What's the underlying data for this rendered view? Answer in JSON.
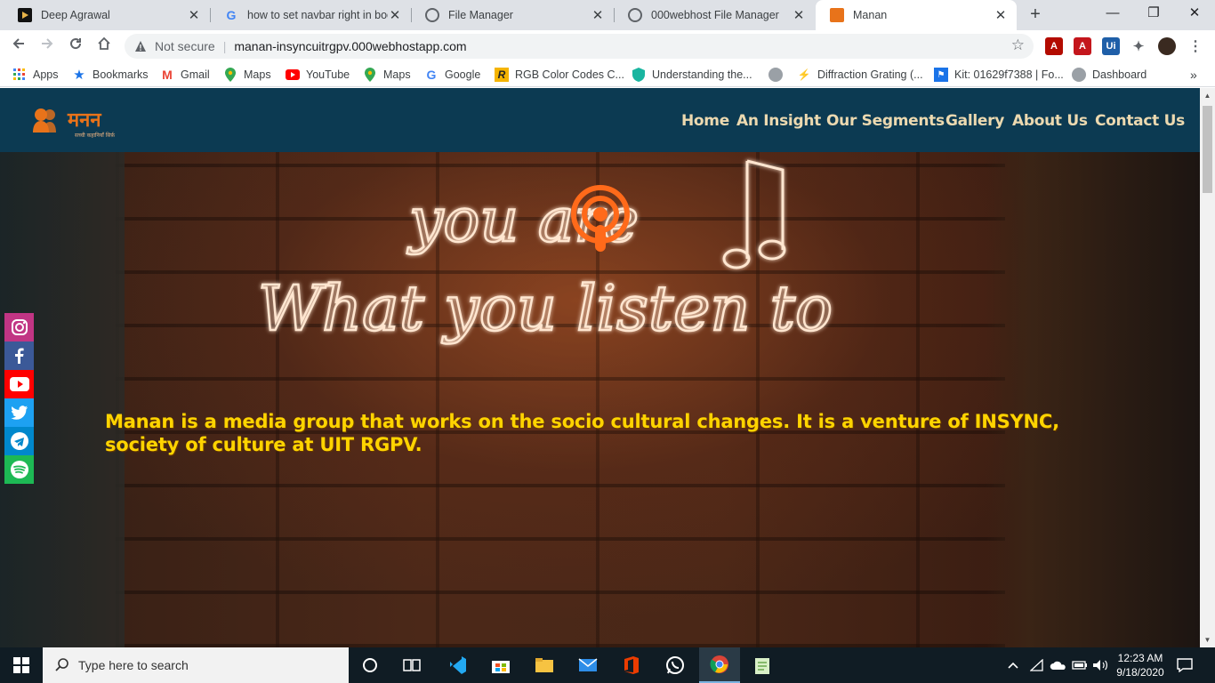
{
  "browser": {
    "tabs": [
      {
        "title": "Deep Agrawal",
        "favicon": "video-icon",
        "color": "#1a1a1a"
      },
      {
        "title": "how to set navbar right in boo",
        "favicon": "google-icon",
        "color": "#4285f4"
      },
      {
        "title": "File Manager",
        "favicon": "globe-icon",
        "color": "#5f6368"
      },
      {
        "title": "000webhost File Manager",
        "favicon": "globe-icon",
        "color": "#5f6368"
      },
      {
        "title": "Manan",
        "favicon": "manan-icon",
        "color": "#e8731a"
      }
    ],
    "address": {
      "security": "Not secure",
      "url": "manan-insyncuitrgpv.000webhostapp.com"
    },
    "bookmarks": [
      {
        "label": "Apps",
        "icon": "apps-grid-icon"
      },
      {
        "label": "Bookmarks",
        "icon": "star-icon"
      },
      {
        "label": "Gmail",
        "icon": "gmail-icon"
      },
      {
        "label": "Maps",
        "icon": "maps-pin-icon"
      },
      {
        "label": "YouTube",
        "icon": "youtube-icon"
      },
      {
        "label": "Maps",
        "icon": "maps-pin-icon"
      },
      {
        "label": "Google",
        "icon": "google-icon"
      },
      {
        "label": "RGB Color Codes C...",
        "icon": "rgb-icon"
      },
      {
        "label": "Understanding the...",
        "icon": "shield-icon"
      },
      {
        "label": "",
        "icon": "globe-icon"
      },
      {
        "label": "Diffraction Grating (...",
        "icon": "diffraction-icon"
      },
      {
        "label": "Kit: 01629f7388 | Fo...",
        "icon": "flag-icon"
      },
      {
        "label": "Dashboard",
        "icon": "globe-icon"
      }
    ],
    "bookmarks_overflow": "»"
  },
  "site": {
    "logo_text": "मनन",
    "logo_subtext": "सच्ची कहानियाँ सिर्फ़",
    "nav": [
      "Home",
      "An Insight",
      "Our Segments",
      "Gallery",
      "About Us",
      "Contact Us"
    ],
    "hero_neon_line1": "you are",
    "hero_neon_line2": "What you listen to",
    "tagline": "Manan is a media group that works on the socio cultural changes. It is a venture of INSYNC, society of culture at UIT RGPV.",
    "social": [
      {
        "name": "instagram",
        "color": "#c13584"
      },
      {
        "name": "facebook",
        "color": "#3b5998"
      },
      {
        "name": "youtube",
        "color": "#ff0000"
      },
      {
        "name": "twitter",
        "color": "#1da1f2"
      },
      {
        "name": "telegram",
        "color": "#0088cc"
      },
      {
        "name": "spotify",
        "color": "#1db954"
      }
    ]
  },
  "taskbar": {
    "search_placeholder": "Type here to search",
    "time": "12:23 AM",
    "date": "9/18/2020"
  }
}
